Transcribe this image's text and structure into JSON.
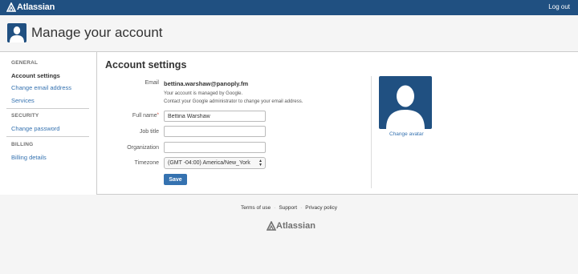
{
  "topbar": {
    "brand": "Atlassian",
    "logout_label": "Log out"
  },
  "header": {
    "title": "Manage your account"
  },
  "sidebar": {
    "sections": [
      {
        "heading": "GENERAL",
        "items": [
          "Account settings",
          "Change email address",
          "Services"
        ]
      },
      {
        "heading": "SECURITY",
        "items": [
          "Change password"
        ]
      },
      {
        "heading": "BILLING",
        "items": [
          "Billing details"
        ]
      }
    ],
    "active": "Account settings"
  },
  "form": {
    "title": "Account settings",
    "email_label": "Email",
    "email_value": "bettina.warshaw@panoply.fm",
    "email_note_1": "Your account is managed by Google.",
    "email_note_2": "Contact your Google administrator to change your email address.",
    "fullname_label": "Full name",
    "fullname_value": "Bettina Warshaw",
    "jobtitle_label": "Job title",
    "jobtitle_value": "",
    "organization_label": "Organization",
    "organization_value": "",
    "timezone_label": "Timezone",
    "timezone_value": "(GMT -04:00) America/New_York",
    "save_label": "Save"
  },
  "avatar": {
    "change_label": "Change avatar"
  },
  "footer": {
    "links": [
      "Terms of use",
      "Support",
      "Privacy policy"
    ],
    "brand": "Atlassian"
  },
  "colors": {
    "brand": "#205081",
    "link": "#3572b0",
    "required": "#d04437"
  }
}
